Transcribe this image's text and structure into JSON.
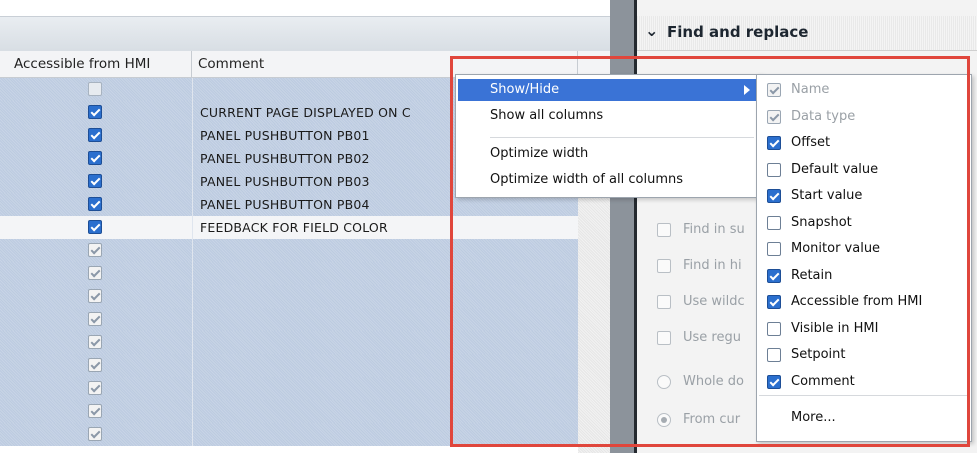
{
  "table": {
    "header": {
      "accessible": "Accessible from HMI",
      "comment": "Comment"
    },
    "rows": [
      {
        "state": "empty-disabled",
        "comment": ""
      },
      {
        "state": "checked",
        "comment": "CURRENT PAGE DISPLAYED ON C"
      },
      {
        "state": "checked",
        "comment": "PANEL PUSHBUTTON PB01"
      },
      {
        "state": "checked",
        "comment": "PANEL PUSHBUTTON PB02"
      },
      {
        "state": "checked",
        "comment": "PANEL PUSHBUTTON PB03"
      },
      {
        "state": "checked",
        "comment": "PANEL PUSHBUTTON PB04"
      },
      {
        "state": "checked",
        "comment": "FEEDBACK FOR FIELD COLOR",
        "selected": true
      },
      {
        "state": "disabled",
        "comment": ""
      },
      {
        "state": "disabled",
        "comment": ""
      },
      {
        "state": "disabled",
        "comment": ""
      },
      {
        "state": "disabled",
        "comment": ""
      },
      {
        "state": "disabled",
        "comment": ""
      },
      {
        "state": "disabled",
        "comment": ""
      },
      {
        "state": "disabled",
        "comment": ""
      },
      {
        "state": "disabled",
        "comment": ""
      },
      {
        "state": "disabled",
        "comment": ""
      }
    ]
  },
  "find_panel": {
    "title": "Find and replace",
    "chevron_icon": "chevron-down-icon",
    "options": [
      {
        "kind": "checkbox",
        "label": "Find in su"
      },
      {
        "kind": "checkbox",
        "label": "Find in hi"
      },
      {
        "kind": "checkbox",
        "label": "Use wildc"
      },
      {
        "kind": "checkbox",
        "label": "Use regu"
      },
      {
        "kind": "radio",
        "label": "Whole do",
        "selected": false
      },
      {
        "kind": "radio",
        "label": "From cur",
        "selected": true
      }
    ]
  },
  "context_menu": {
    "items": [
      {
        "label": "Show/Hide",
        "highlighted": true,
        "has_submenu": true
      },
      {
        "label": "Show all columns"
      },
      {
        "label": "Optimize width"
      },
      {
        "label": "Optimize width of all columns"
      }
    ]
  },
  "submenu": {
    "items": [
      {
        "label": "Name",
        "state": "disabled-checked"
      },
      {
        "label": "Data type",
        "state": "disabled-checked"
      },
      {
        "label": "Offset",
        "state": "checked"
      },
      {
        "label": "Default value",
        "state": "unchecked"
      },
      {
        "label": "Start value",
        "state": "checked"
      },
      {
        "label": "Snapshot",
        "state": "unchecked"
      },
      {
        "label": "Monitor value",
        "state": "unchecked"
      },
      {
        "label": "Retain",
        "state": "checked"
      },
      {
        "label": "Accessible from HMI",
        "state": "checked"
      },
      {
        "label": "Visible in HMI",
        "state": "unchecked"
      },
      {
        "label": "Setpoint",
        "state": "unchecked"
      },
      {
        "label": "Comment",
        "state": "checked"
      }
    ],
    "more_label": "More..."
  },
  "colors": {
    "highlight": "#3a73d6",
    "checkbox_checked": "#2b6fce",
    "annotation_red": "#e0463c",
    "row_selection": "#c3cfe3"
  }
}
